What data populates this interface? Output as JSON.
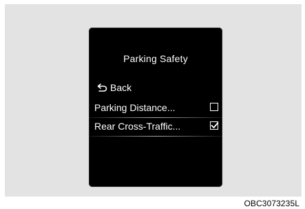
{
  "screen": {
    "title": "Parking Safety",
    "back": {
      "icon": "back-arrow-icon",
      "label": "Back"
    },
    "items": [
      {
        "label": "Parking Distance...",
        "checked": false,
        "selected": false
      },
      {
        "label": "Rear Cross-Traffic...",
        "checked": true,
        "selected": true
      }
    ]
  },
  "caption": "OBC3073235L"
}
